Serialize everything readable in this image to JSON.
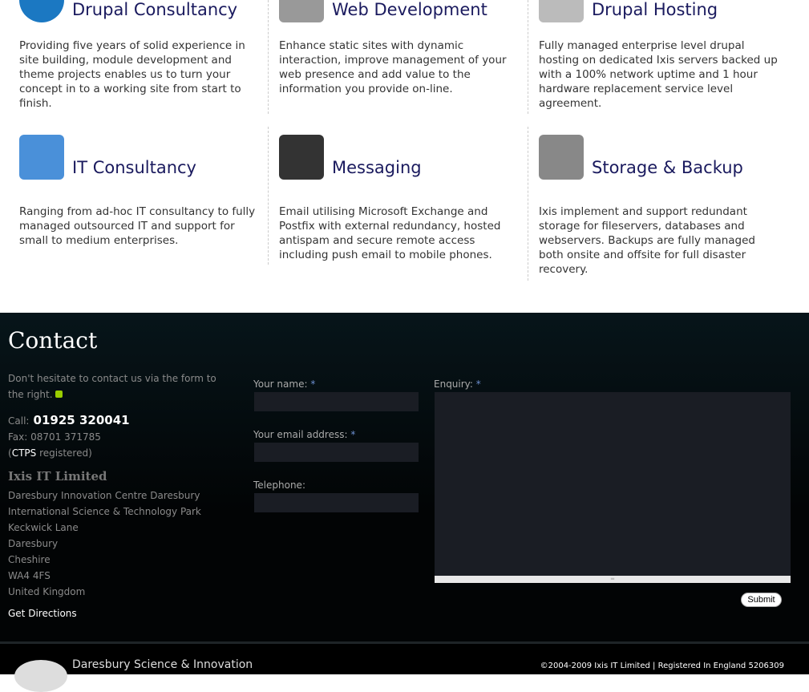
{
  "services": [
    {
      "title": "Drupal Consultancy",
      "icon": "drupal-icon",
      "text": "Providing five years of solid experience in site building, module development and theme projects enables us to turn your concept in to a working site from start to finish."
    },
    {
      "title": "Web Development",
      "icon": "mouse-icon",
      "text": "Enhance static sites with dynamic interaction, improve management of your web presence and add value to the information you provide on-line."
    },
    {
      "title": "Drupal Hosting",
      "icon": "server-icon",
      "text": "Fully managed enterprise level drupal hosting on dedicated Ixis servers backed up with a 100% network uptime and 1 hour hardware replacement service level agreement."
    },
    {
      "title": "IT Consultancy",
      "icon": "imac-icon",
      "text": "Ranging from ad-hoc IT consultancy to fully managed outsourced IT and support for small to medium enterprises."
    },
    {
      "title": "Messaging",
      "icon": "phone-exchange-icon",
      "text": "Email utilising Microsoft Exchange and Postfix with external redundancy, hosted antispam and secure remote access including push email to mobile phones."
    },
    {
      "title": "Storage & Backup",
      "icon": "storage-rack-icon",
      "text": "Ixis implement and support redundant storage for fileservers, databases and webservers. Backups are fully managed both onsite and offsite for full disaster recovery."
    }
  ],
  "contact": {
    "title": "Contact",
    "intro": "Don't hesitate to contact us via the form to the right.",
    "call_label": "Call:",
    "phone": "01925 320041",
    "fax": "Fax: 08701 371785",
    "ctps_pre": "(",
    "ctps": "CTPS",
    "ctps_post": " registered)",
    "company": "Ixis IT Limited",
    "address": [
      "Daresbury Innovation Centre Daresbury",
      "International Science & Technology Park",
      "Keckwick Lane",
      "Daresbury",
      "Cheshire",
      "WA4 4FS",
      "United Kingdom"
    ],
    "directions": "Get Directions",
    "form": {
      "name_label": "Your name:",
      "email_label": "Your email address:",
      "phone_label": "Telephone:",
      "enquiry_label": "Enquiry:",
      "required": "*",
      "submit": "Submit"
    }
  },
  "footer": {
    "partner": "Daresbury Science & Innovation",
    "copyright": "©2004-2009 Ixis IT Limited | Registered In England 5206309"
  }
}
